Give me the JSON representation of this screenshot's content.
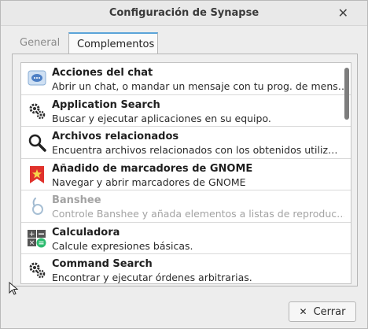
{
  "window": {
    "title": "Configuración de Synapse"
  },
  "tabs": [
    {
      "label": "General"
    },
    {
      "label": "Complementos"
    }
  ],
  "plugins": [
    {
      "name": "Acciones del chat",
      "description": "Abrir un chat, o mandar un mensaje con tu prog. de mens…",
      "icon": "chat-icon",
      "enabled": true
    },
    {
      "name": "Application Search",
      "description": "Buscar y ejecutar aplicaciones en su equipo.",
      "icon": "gears-icon",
      "enabled": true
    },
    {
      "name": "Archivos relacionados",
      "description": "Encuentra archivos relacionados con los obtenidos utiliz…",
      "icon": "magnifier-icon",
      "enabled": true
    },
    {
      "name": "Añadido de marcadores de GNOME",
      "description": "Navegar y abrir marcadores de GNOME",
      "icon": "bookmark-icon",
      "enabled": true
    },
    {
      "name": "Banshee",
      "description": "Controle Banshee y añada elementos a listas de reproduc…",
      "icon": "banshee-icon",
      "enabled": false
    },
    {
      "name": "Calculadora",
      "description": "Calcule expresiones básicas.",
      "icon": "calculator-icon",
      "enabled": true
    },
    {
      "name": "Command Search",
      "description": "Encontrar y ejecutar órdenes arbitrarias.",
      "icon": "gears-icon",
      "enabled": true
    }
  ],
  "footer": {
    "close_label": "Cerrar"
  }
}
